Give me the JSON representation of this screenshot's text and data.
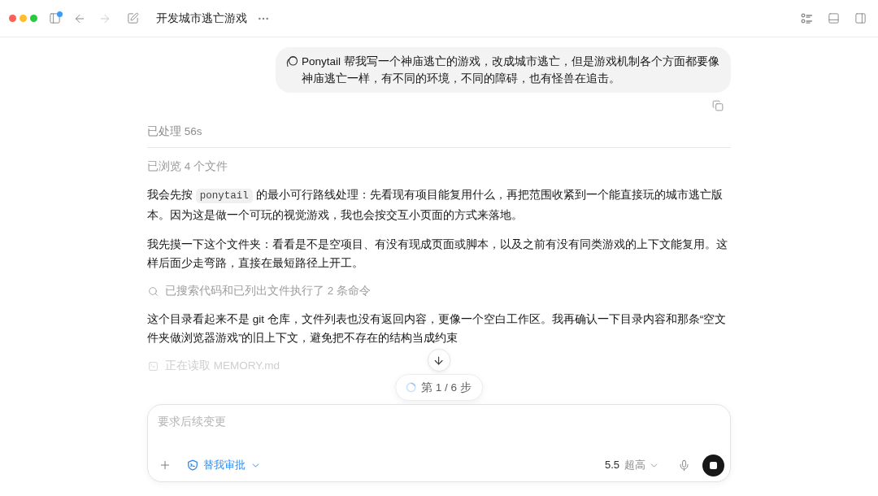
{
  "window": {
    "title": "开发城市逃亡游戏"
  },
  "toolbar": {
    "sidebar_badge": true,
    "back": {
      "disabled": false
    },
    "forward": {
      "disabled": true
    }
  },
  "user_message": {
    "text": "Ponytail 帮我写一个神庙逃亡的游戏，改成城市逃亡，但是游戏机制各个方面都要像神庙逃亡一样，有不同的环境，不同的障碍，也有怪兽在追击。"
  },
  "processed": "已处理 56s",
  "transcript": [
    {
      "kind": "activity",
      "text": "已浏览 4 个文件"
    },
    {
      "kind": "paragraph",
      "parts": [
        {
          "kind": "text",
          "text": "我会先按 "
        },
        {
          "kind": "code",
          "text": "ponytail"
        },
        {
          "kind": "text",
          "text": " 的最小可行路线处理：先看现有项目能复用什么，再把范围收紧到一个能直接玩的城市逃亡版本。因为这是做一个可玩的视觉游戏，我也会按交互小页面的方式来落地。"
        }
      ]
    },
    {
      "kind": "paragraph",
      "parts": [
        {
          "kind": "text",
          "text": "我先摸一下这个文件夹：看看是不是空项目、有没有现成页面或脚本，以及之前有没有同类游戏的上下文能复用。这样后面少走弯路，直接在最短路径上开工。"
        }
      ]
    },
    {
      "kind": "search",
      "text": "已搜索代码和已列出文件执行了 2 条命令"
    },
    {
      "kind": "paragraph",
      "parts": [
        {
          "kind": "text",
          "text": "这个目录看起来不是 git 仓库，文件列表也没有返回内容，更像一个空白工作区。我再确认一下目录内容和那条“空文件夹做浏览器游戏”的旧上下文，避免把不存在的结构当成约束"
        }
      ]
    },
    {
      "kind": "command",
      "text": "正在读取 MEMORY.md"
    }
  ],
  "step_indicator": "第 1 / 6 步",
  "composer": {
    "placeholder": "要求后续变更",
    "approval": "替我审批",
    "model": {
      "version": "5.5",
      "effort": "超高"
    },
    "running": true
  }
}
